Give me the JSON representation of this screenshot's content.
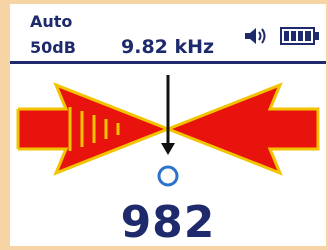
{
  "status": {
    "mode": "Auto",
    "gain": "50dB",
    "frequency": "9.82 kHz",
    "speaker_icon": "speaker-volume-icon",
    "battery_icon": "battery-full-icon",
    "battery_level": 1.0
  },
  "indicator": {
    "left_arrow_icon": "left-direction-arrow",
    "right_arrow_icon": "right-direction-arrow",
    "pointer_icon": "down-pointer-arrow",
    "target_icon": "target-circle-icon",
    "arrow_fill_color": "#e8130c",
    "arrow_outline_color": "#f2c400",
    "accent_color": "#1e2a6b",
    "circle_color": "#2b72c9"
  },
  "reading": {
    "signal_strength": "982"
  }
}
